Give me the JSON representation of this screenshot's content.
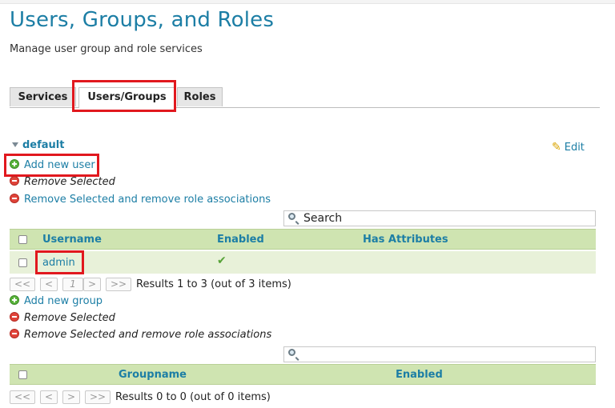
{
  "page": {
    "title": "Users, Groups, and Roles",
    "subtitle": "Manage user group and role services"
  },
  "tabs": [
    {
      "label": "Services",
      "active": false
    },
    {
      "label": "Users/Groups",
      "active": true
    },
    {
      "label": "Roles",
      "active": false
    }
  ],
  "service": {
    "name": "default",
    "edit_label": "Edit"
  },
  "users": {
    "add_label": "Add new user",
    "remove_label": "Remove Selected",
    "remove_assoc_label": "Remove Selected and remove role associations",
    "search_placeholder": "Search",
    "columns": [
      "Username",
      "Enabled",
      "Has Attributes"
    ],
    "rows": [
      {
        "username": "admin",
        "enabled": true,
        "has_attributes": false
      }
    ],
    "pager": {
      "first": "<<",
      "prev": "<",
      "page": "1",
      "next": ">",
      "last": ">>",
      "summary": "Results 1 to 3 (out of 3 items)"
    }
  },
  "groups": {
    "add_label": "Add new group",
    "remove_label": "Remove Selected",
    "remove_assoc_label": "Remove Selected and remove role associations",
    "search_placeholder": "",
    "columns": [
      "Groupname",
      "Enabled"
    ],
    "pager": {
      "first": "<<",
      "prev": "<",
      "next": ">",
      "last": ">>",
      "summary": "Results 0 to 0 (out of 0 items)"
    }
  },
  "colors": {
    "link": "#1c7ea5",
    "highlight": "#e1181e",
    "table_header": "#cfe4b1",
    "row": "#e8f1d9"
  }
}
